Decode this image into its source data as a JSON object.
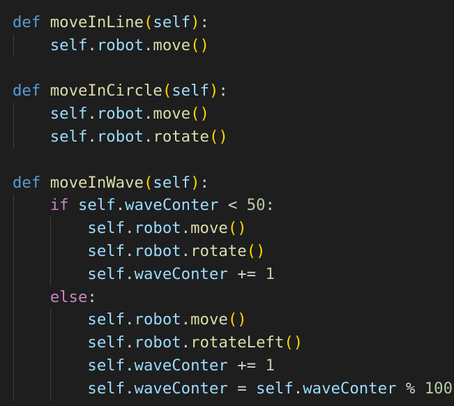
{
  "editor": {
    "language": "python",
    "colors": {
      "background": "#1e1e1e",
      "keyword_def": "#569cd6",
      "keyword_control": "#c586c0",
      "function_name": "#dcdcaa",
      "variable": "#9cdcfe",
      "number": "#b5cea8",
      "bracket_level1": "#ffd700",
      "bracket_level2": "#da70d6",
      "text": "#d4d4d4"
    },
    "lines": [
      [
        {
          "t": "def",
          "c": "kw-def"
        },
        {
          "t": " ",
          "c": "pl"
        },
        {
          "t": "moveInLine",
          "c": "fn"
        },
        {
          "t": "(",
          "c": "paren"
        },
        {
          "t": "self",
          "c": "var"
        },
        {
          "t": ")",
          "c": "paren"
        },
        {
          "t": ":",
          "c": "pl"
        }
      ],
      [
        {
          "t": "    ",
          "c": "pl"
        },
        {
          "t": "self",
          "c": "var"
        },
        {
          "t": ".",
          "c": "pl"
        },
        {
          "t": "robot",
          "c": "var"
        },
        {
          "t": ".",
          "c": "pl"
        },
        {
          "t": "move",
          "c": "fn"
        },
        {
          "t": "()",
          "c": "paren"
        }
      ],
      [],
      [
        {
          "t": "def",
          "c": "kw-def"
        },
        {
          "t": " ",
          "c": "pl"
        },
        {
          "t": "moveInCircle",
          "c": "fn"
        },
        {
          "t": "(",
          "c": "paren"
        },
        {
          "t": "self",
          "c": "var"
        },
        {
          "t": ")",
          "c": "paren"
        },
        {
          "t": ":",
          "c": "pl"
        }
      ],
      [
        {
          "t": "    ",
          "c": "pl"
        },
        {
          "t": "self",
          "c": "var"
        },
        {
          "t": ".",
          "c": "pl"
        },
        {
          "t": "robot",
          "c": "var"
        },
        {
          "t": ".",
          "c": "pl"
        },
        {
          "t": "move",
          "c": "fn"
        },
        {
          "t": "()",
          "c": "paren"
        }
      ],
      [
        {
          "t": "    ",
          "c": "pl"
        },
        {
          "t": "self",
          "c": "var"
        },
        {
          "t": ".",
          "c": "pl"
        },
        {
          "t": "robot",
          "c": "var"
        },
        {
          "t": ".",
          "c": "pl"
        },
        {
          "t": "rotate",
          "c": "fn"
        },
        {
          "t": "()",
          "c": "paren"
        }
      ],
      [],
      [
        {
          "t": "def",
          "c": "kw-def"
        },
        {
          "t": " ",
          "c": "pl"
        },
        {
          "t": "moveInWave",
          "c": "fn"
        },
        {
          "t": "(",
          "c": "paren"
        },
        {
          "t": "self",
          "c": "var"
        },
        {
          "t": ")",
          "c": "paren"
        },
        {
          "t": ":",
          "c": "pl"
        }
      ],
      [
        {
          "t": "    ",
          "c": "pl"
        },
        {
          "t": "if",
          "c": "kw-ctl"
        },
        {
          "t": " ",
          "c": "pl"
        },
        {
          "t": "self",
          "c": "var"
        },
        {
          "t": ".",
          "c": "pl"
        },
        {
          "t": "waveConter",
          "c": "var"
        },
        {
          "t": " < ",
          "c": "op"
        },
        {
          "t": "50",
          "c": "num"
        },
        {
          "t": ":",
          "c": "pl"
        }
      ],
      [
        {
          "t": "        ",
          "c": "pl"
        },
        {
          "t": "self",
          "c": "var"
        },
        {
          "t": ".",
          "c": "pl"
        },
        {
          "t": "robot",
          "c": "var"
        },
        {
          "t": ".",
          "c": "pl"
        },
        {
          "t": "move",
          "c": "fn"
        },
        {
          "t": "()",
          "c": "paren"
        }
      ],
      [
        {
          "t": "        ",
          "c": "pl"
        },
        {
          "t": "self",
          "c": "var"
        },
        {
          "t": ".",
          "c": "pl"
        },
        {
          "t": "robot",
          "c": "var"
        },
        {
          "t": ".",
          "c": "pl"
        },
        {
          "t": "rotate",
          "c": "fn"
        },
        {
          "t": "()",
          "c": "paren"
        }
      ],
      [
        {
          "t": "        ",
          "c": "pl"
        },
        {
          "t": "self",
          "c": "var"
        },
        {
          "t": ".",
          "c": "pl"
        },
        {
          "t": "waveConter",
          "c": "var"
        },
        {
          "t": " += ",
          "c": "op"
        },
        {
          "t": "1",
          "c": "num"
        }
      ],
      [
        {
          "t": "    ",
          "c": "pl"
        },
        {
          "t": "else",
          "c": "kw-ctl"
        },
        {
          "t": ":",
          "c": "pl"
        }
      ],
      [
        {
          "t": "        ",
          "c": "pl"
        },
        {
          "t": "self",
          "c": "var"
        },
        {
          "t": ".",
          "c": "pl"
        },
        {
          "t": "robot",
          "c": "var"
        },
        {
          "t": ".",
          "c": "pl"
        },
        {
          "t": "move",
          "c": "fn"
        },
        {
          "t": "()",
          "c": "paren"
        }
      ],
      [
        {
          "t": "        ",
          "c": "pl"
        },
        {
          "t": "self",
          "c": "var"
        },
        {
          "t": ".",
          "c": "pl"
        },
        {
          "t": "robot",
          "c": "var"
        },
        {
          "t": ".",
          "c": "pl"
        },
        {
          "t": "rotateLeft",
          "c": "fn"
        },
        {
          "t": "()",
          "c": "paren"
        }
      ],
      [
        {
          "t": "        ",
          "c": "pl"
        },
        {
          "t": "self",
          "c": "var"
        },
        {
          "t": ".",
          "c": "pl"
        },
        {
          "t": "waveConter",
          "c": "var"
        },
        {
          "t": " += ",
          "c": "op"
        },
        {
          "t": "1",
          "c": "num"
        }
      ],
      [
        {
          "t": "        ",
          "c": "pl"
        },
        {
          "t": "self",
          "c": "var"
        },
        {
          "t": ".",
          "c": "pl"
        },
        {
          "t": "waveConter",
          "c": "var"
        },
        {
          "t": " = ",
          "c": "op"
        },
        {
          "t": "self",
          "c": "var"
        },
        {
          "t": ".",
          "c": "pl"
        },
        {
          "t": "waveConter",
          "c": "var"
        },
        {
          "t": " % ",
          "c": "op"
        },
        {
          "t": "100",
          "c": "num"
        }
      ]
    ]
  }
}
